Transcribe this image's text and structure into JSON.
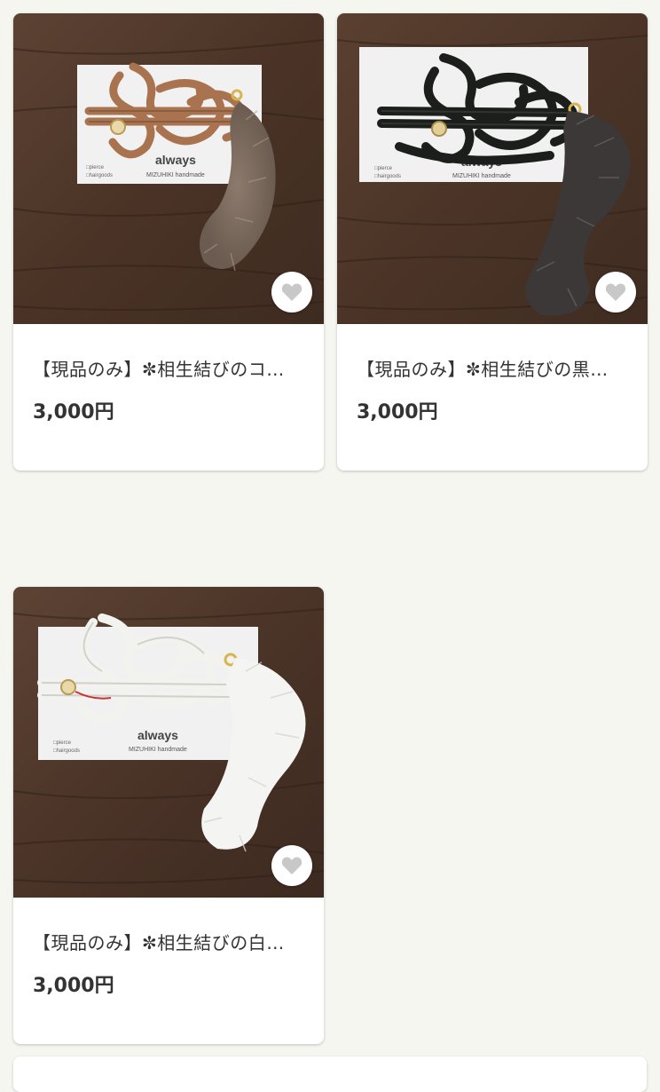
{
  "products": [
    {
      "title": "【現品のみ】✼相生結びのコ…",
      "price": "3,000円",
      "variant": "brown"
    },
    {
      "title": "【現品のみ】✼相生結びの黒…",
      "price": "3,000円",
      "variant": "black"
    },
    {
      "title": "【現品のみ】✼相生結びの白…",
      "price": "3,000円",
      "variant": "white"
    }
  ],
  "tag_card": {
    "brand": "always",
    "subtitle": "MIZUHIKI handmade",
    "option_1": "□pierce",
    "option_2": "□hairgoods"
  },
  "icons": {
    "favorite": "heart-icon"
  },
  "colors": {
    "background": "#f6f6f1",
    "card": "#ffffff",
    "text": "#333333",
    "heart": "#c8c8c8"
  }
}
